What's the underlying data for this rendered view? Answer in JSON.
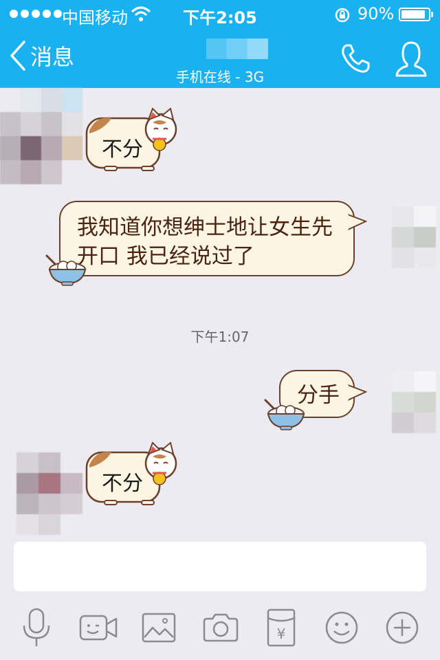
{
  "status_bar": {
    "carrier": "中国移动",
    "time": "下午2:05",
    "battery_percent": "90%",
    "battery_level": 0.9
  },
  "nav": {
    "back_label": "消息",
    "subtitle": "手机在线 - 3G"
  },
  "messages": [
    {
      "side": "left",
      "kind": "sticker",
      "text": "不分"
    },
    {
      "side": "left",
      "kind": "text",
      "lines": [
        "我知道你想绅士地让女生先",
        "开口 我已经说过了"
      ]
    },
    {
      "side": "center",
      "kind": "timestamp",
      "text": "下午1:07"
    },
    {
      "side": "right",
      "kind": "text",
      "text": "分手"
    },
    {
      "side": "left",
      "kind": "sticker",
      "text": "不分"
    }
  ],
  "input": {
    "placeholder": ""
  },
  "toolbar": {
    "icons": [
      "microphone-icon",
      "video-icon",
      "image-icon",
      "camera-icon",
      "red-packet-icon",
      "emoji-icon",
      "plus-icon"
    ],
    "red_packet_symbol": "¥"
  },
  "colors": {
    "header": "#1ab1f0",
    "background": "#ecebf1",
    "bubble_fill": "#fdf5e3",
    "bubble_border": "#6b3f2a"
  }
}
